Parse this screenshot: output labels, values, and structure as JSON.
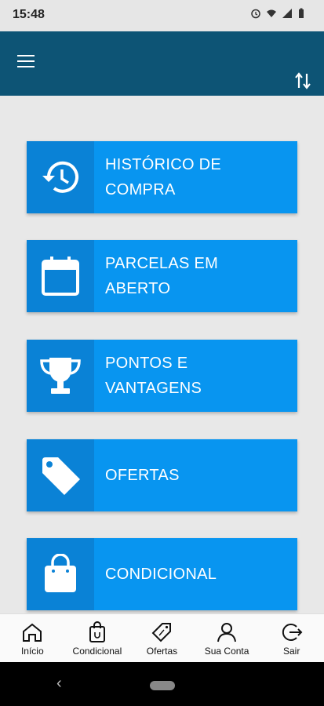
{
  "status": {
    "time": "15:48"
  },
  "menu": [
    {
      "label": "HISTÓRICO DE\nCOMPRA",
      "icon": "history-icon"
    },
    {
      "label": "PARCELAS EM\nABERTO",
      "icon": "calendar-icon"
    },
    {
      "label": "PONTOS E\nVANTAGENS",
      "icon": "trophy-icon"
    },
    {
      "label": "OFERTAS",
      "icon": "tag-icon"
    },
    {
      "label": "CONDICIONAL",
      "icon": "shopping-bag-icon"
    }
  ],
  "bottom_nav": [
    {
      "label": "Início",
      "icon": "home-icon"
    },
    {
      "label": "Condicional",
      "icon": "bag-icon"
    },
    {
      "label": "Ofertas",
      "icon": "discount-tag-icon"
    },
    {
      "label": "Sua Conta",
      "icon": "user-icon"
    },
    {
      "label": "Sair",
      "icon": "logout-icon"
    }
  ],
  "colors": {
    "app_bar": "#0d5475",
    "card": "#0895f0",
    "card_icon_box": "#0a82d6"
  }
}
